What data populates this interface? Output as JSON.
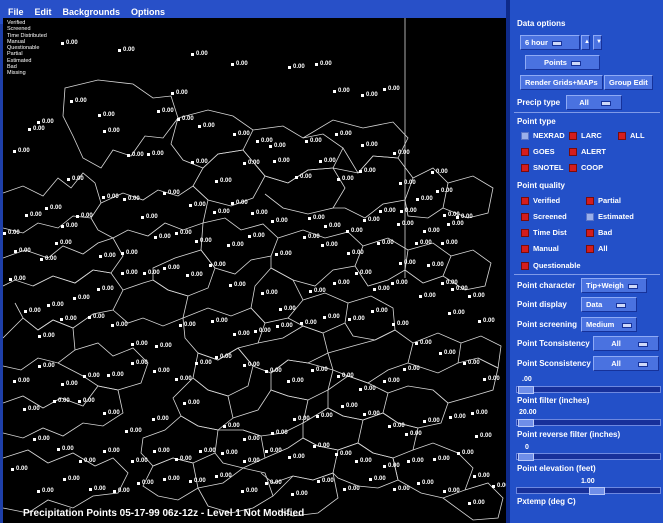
{
  "menubar": {
    "items": [
      "File",
      "Edit",
      "Backgrounds",
      "Options"
    ]
  },
  "map": {
    "legend": [
      "Verified",
      "Screened",
      "Time Distributed",
      "Manual",
      "Questionable",
      "Partial",
      "Estimated",
      "Bad",
      "Missing"
    ],
    "point_label": "0.00",
    "status_text": "Precipitation Points 05-17-99 06z-12z - Level 1 Not Modified"
  },
  "panel": {
    "data_options_label": "Data options",
    "duration_value": "6 hour",
    "up_arrow": "▲",
    "down_arrow": "▼",
    "display_mode_value": "Points",
    "render_button": "Render Grids+MAPs",
    "group_edit_button": "Group Edit",
    "precip_type_label": "Precip type",
    "precip_type_value": "All",
    "point_type_label": "Point type",
    "point_types": [
      {
        "label": "NEXRAD",
        "checked": false
      },
      {
        "label": "LARC",
        "checked": true
      },
      {
        "label": "ALL",
        "checked": true
      },
      {
        "label": "GOES",
        "checked": true
      },
      {
        "label": "ALERT",
        "checked": true
      },
      {
        "label": "SNOTEL",
        "checked": true
      },
      {
        "label": "COOP",
        "checked": true
      }
    ],
    "point_quality_label": "Point quality",
    "point_qualities": [
      {
        "label": "Verified",
        "checked": true
      },
      {
        "label": "Partial",
        "checked": true
      },
      {
        "label": "Screened",
        "checked": true
      },
      {
        "label": "Estimated",
        "checked": false
      },
      {
        "label": "Time Dist",
        "checked": true
      },
      {
        "label": "Bad",
        "checked": true
      },
      {
        "label": "Manual",
        "checked": true
      },
      {
        "label": "All",
        "checked": true
      },
      {
        "label": "Questionable",
        "checked": true
      }
    ],
    "point_character_label": "Point character",
    "point_character_value": "Tip+Weigh",
    "point_display_label": "Point display",
    "point_display_value": "Data",
    "point_screening_label": "Point screening",
    "point_screening_value": "Medium",
    "point_tconsistency_label": "Point Tconsistency",
    "point_tconsistency_value": "All",
    "point_sconsistency_label": "Point Sconsistency",
    "point_sconsistency_value": "All",
    "point_filter_value": ".00",
    "point_filter_label": "Point filter (inches)",
    "reverse_filter_value": "20.00",
    "reverse_filter_label": "Point reverse filter (inches)",
    "elevation_value": "0",
    "elevation_label": "Point elevation (feet)",
    "pxtemp_value": "1.00",
    "pxtemp_label": "Pxtemp (deg C)"
  }
}
